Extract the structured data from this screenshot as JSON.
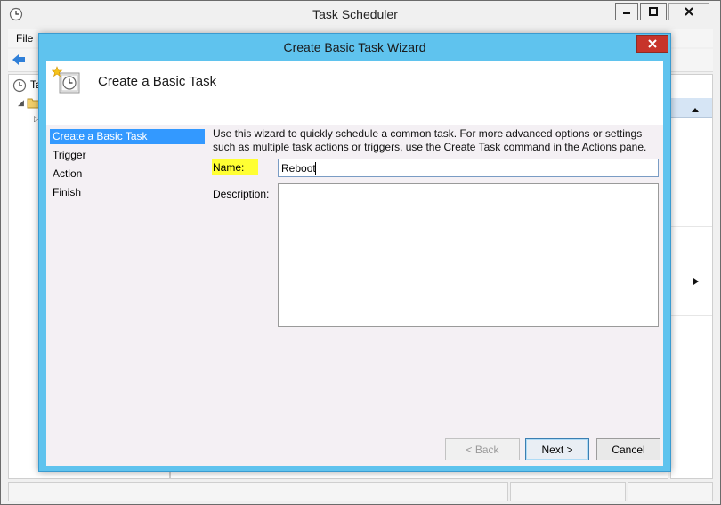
{
  "main_window": {
    "title": "Task Scheduler",
    "menu": {
      "file": "File"
    },
    "tree": {
      "root_label": "Ta"
    }
  },
  "wizard": {
    "title": "Create Basic Task Wizard",
    "header_title": "Create a Basic Task",
    "steps": [
      {
        "label": "Create a Basic Task",
        "active": true
      },
      {
        "label": "Trigger",
        "active": false
      },
      {
        "label": "Action",
        "active": false
      },
      {
        "label": "Finish",
        "active": false
      }
    ],
    "intro": "Use this wizard to quickly schedule a common task.  For more advanced options or settings such as multiple task actions or triggers, use the Create Task command in the Actions pane.",
    "name_label": "Name:",
    "name_value": "Reboot",
    "description_label": "Description:",
    "description_value": "",
    "buttons": {
      "back": "< Back",
      "next": "Next >",
      "cancel": "Cancel"
    }
  },
  "colors": {
    "wizard_frame": "#5fc3ee",
    "close_button": "#c7342a",
    "selected_step": "#3399ff",
    "name_highlight": "#ffff33"
  }
}
